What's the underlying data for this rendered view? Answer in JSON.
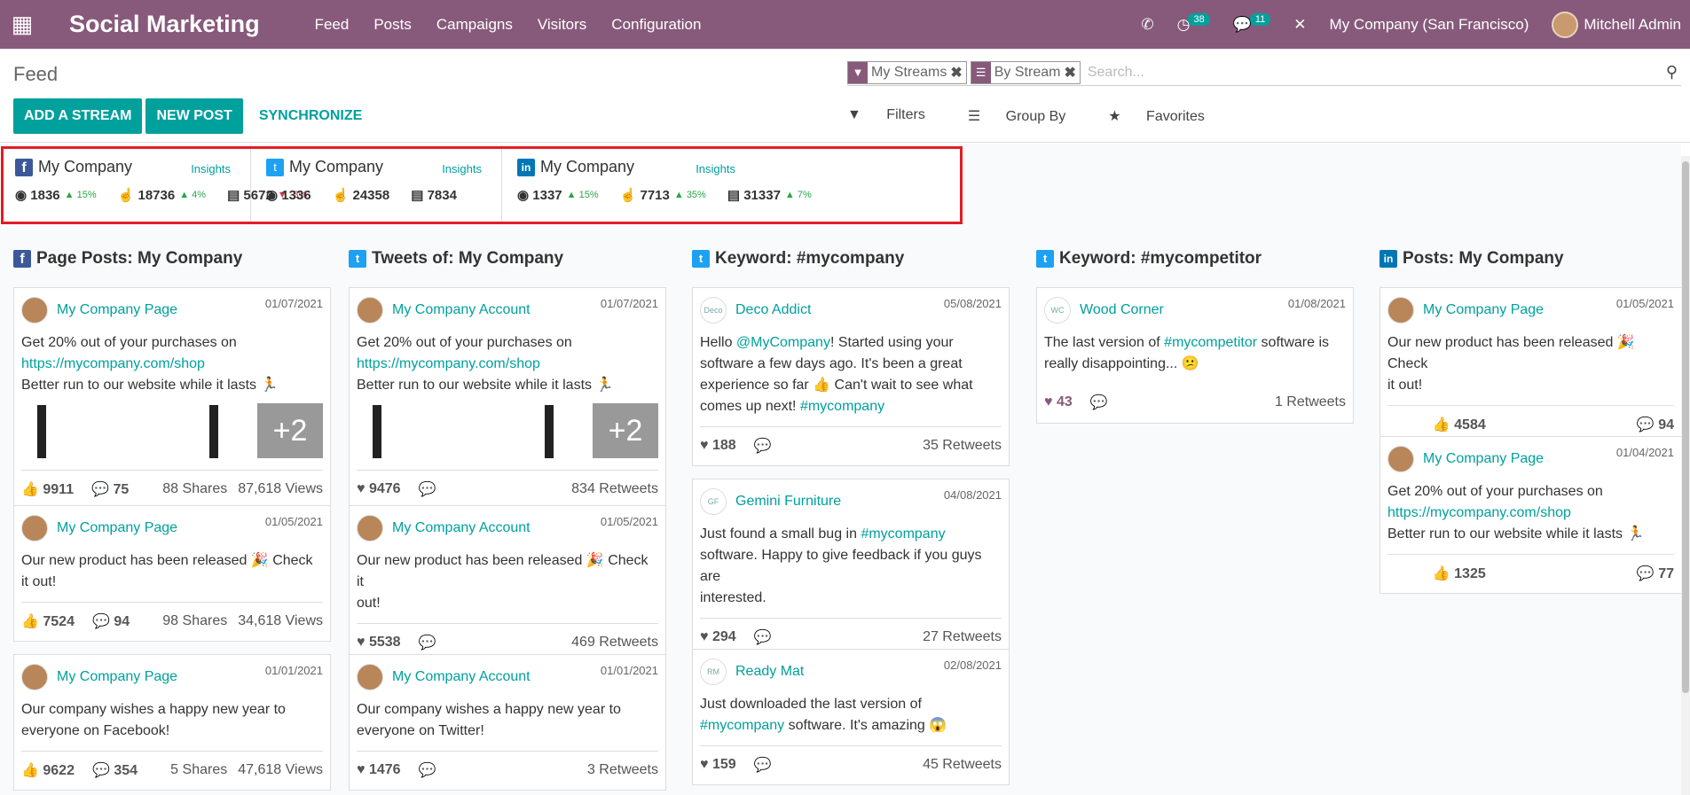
{
  "topbar": {
    "app_title": "Social Marketing",
    "nav": [
      "Feed",
      "Posts",
      "Campaigns",
      "Visitors",
      "Configuration"
    ],
    "activity_count": "38",
    "messages_count": "11",
    "company": "My Company (San Francisco)",
    "user": "Mitchell Admin"
  },
  "control": {
    "breadcrumb": "Feed",
    "add_stream": "ADD A STREAM",
    "new_post": "NEW POST",
    "synchronize": "SYNCHRONIZE",
    "facets": [
      "My Streams",
      "By Stream"
    ],
    "search_placeholder": "Search...",
    "filters": "Filters",
    "group_by": "Group By",
    "favorites": "Favorites"
  },
  "stats": [
    {
      "network": "facebook",
      "name": "My Company",
      "insights": "Insights",
      "a": "1836",
      "a_trend": "15%",
      "b": "18736",
      "b_trend": "4%",
      "c": "5672",
      "c_trend": "-3%"
    },
    {
      "network": "twitter",
      "name": "My Company",
      "insights": "Insights",
      "a": "1336",
      "b": "24358",
      "c": "7834"
    },
    {
      "network": "linkedin",
      "name": "My Company",
      "insights": "Insights",
      "a": "1337",
      "a_trend": "15%",
      "b": "7713",
      "b_trend": "35%",
      "c": "31337",
      "c_trend": "7%"
    }
  ],
  "columns": [
    {
      "title": "Page Posts: My Company",
      "network": "facebook"
    },
    {
      "title": "Tweets of: My Company",
      "network": "twitter"
    },
    {
      "title": "Keyword: #mycompany",
      "network": "twitter"
    },
    {
      "title": "Keyword: #mycompetitor",
      "network": "twitter"
    },
    {
      "title": "Posts: My Company",
      "network": "linkedin"
    }
  ],
  "cards": {
    "c0": [
      {
        "author": "My Company Page",
        "date": "01/07/2021",
        "l1": "Get 20% out of your purchases on",
        "link": "https://mycompany.com/shop",
        "l2": "Better run to our website while it lasts 🏃",
        "plus": "+2",
        "likes": "9911",
        "comments": "75",
        "shares": "88 Shares",
        "views": "87,618 Views"
      },
      {
        "author": "My Company Page",
        "date": "01/05/2021",
        "l1": "Our new product has been released 🎉 Check",
        "l2": "it out!",
        "likes": "7524",
        "comments": "94",
        "shares": "98 Shares",
        "views": "34,618 Views"
      },
      {
        "author": "My Company Page",
        "date": "01/01/2021",
        "l1": "Our company wishes a happy new year to",
        "l2": "everyone on Facebook!",
        "likes": "9622",
        "comments": "354",
        "shares": "5 Shares",
        "views": "47,618 Views"
      }
    ],
    "c1": [
      {
        "author": "My Company Account",
        "date": "01/07/2021",
        "l1": "Get 20% out of your purchases on",
        "link": "https://mycompany.com/shop",
        "l2": "Better run to our website while it lasts 🏃",
        "plus": "+2",
        "likes": "9476",
        "retweets": "834 Retweets"
      },
      {
        "author": "My Company Account",
        "date": "01/05/2021",
        "l1": "Our new product has been released 🎉 Check it",
        "l2": "out!",
        "likes": "5538",
        "retweets": "469 Retweets"
      },
      {
        "author": "My Company Account",
        "date": "01/01/2021",
        "l1": "Our company wishes a happy new year to",
        "l2": "everyone on Twitter!",
        "likes": "1476",
        "retweets": "3 Retweets"
      }
    ],
    "c2": [
      {
        "author": "Deco Addict",
        "date": "05/08/2021",
        "l1a": "Hello ",
        "l1l": "@MyCompany",
        "l1b": "! Started using your",
        "l2": "software a few days ago. It's been a great",
        "l3": "experience so far 👍 Can't wait to see what",
        "l4a": "comes up next! ",
        "l4l": "#mycompany",
        "likes": "188",
        "retweets": "35 Retweets"
      },
      {
        "author": "Gemini Furniture",
        "date": "04/08/2021",
        "l1a": "Just found a small bug in ",
        "l1l": "#mycompany",
        "l2": "software. Happy to give feedback if you guys are",
        "l3": "interested.",
        "likes": "294",
        "retweets": "27 Retweets"
      },
      {
        "author": "Ready Mat",
        "date": "02/08/2021",
        "l1": "Just downloaded the last version of",
        "l2l": "#mycompany",
        "l2b": " software. It's amazing 😱",
        "likes": "159",
        "retweets": "45 Retweets"
      }
    ],
    "c3": [
      {
        "author": "Wood Corner",
        "date": "01/08/2021",
        "l1a": "The last version of ",
        "l1l": "#mycompetitor",
        "l1b": " software is",
        "l2": "really disappointing... 😕",
        "likes": "43",
        "retweets": "1 Retweets"
      }
    ],
    "c4": [
      {
        "author": "My Company Page",
        "date": "01/05/2021",
        "l1": "Our new product has been released 🎉 Check",
        "l2": "it out!",
        "likes": "4584",
        "comments": "94"
      },
      {
        "author": "My Company Page",
        "date": "01/04/2021",
        "l1": "Get 20% out of your purchases on",
        "link": "https://mycompany.com/shop",
        "l2": "Better run to our website while it lasts 🏃",
        "likes": "1325",
        "comments": "77"
      }
    ]
  },
  "colors": {
    "brand": "#875a7b",
    "accent": "#00a09d",
    "highlight": "#e21d24"
  }
}
